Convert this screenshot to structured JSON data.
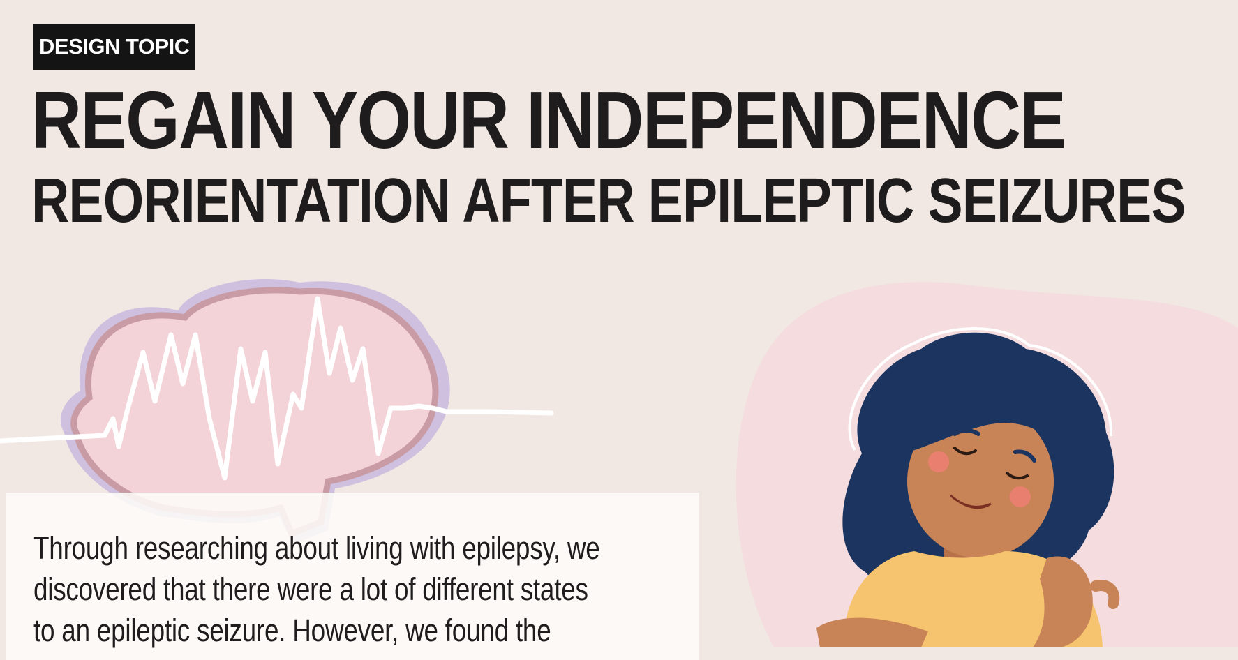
{
  "header": {
    "tag": "DESIGN TOPIC",
    "title": "REGAIN YOUR INDEPENDENCE",
    "subtitle": "REORIENTATION AFTER EPILEPTIC SEIZURES"
  },
  "intro": {
    "lines": [
      "Through researching about living with epilepsy, we",
      "discovered that there were a lot of different states",
      "to an epileptic seizure. However, we found the"
    ]
  },
  "illustrations": {
    "left": "brain-with-eeg-wave-icon",
    "right": "woman-hugging-herself-illustration"
  },
  "colors": {
    "background": "#f1e8e3",
    "text": "#1e1c1c",
    "tag_background": "#141414",
    "brain_fill": "#f3d3d8",
    "brain_outline": "#c99ba4",
    "brain_shadow": "#c5b5dc",
    "hair": "#1b3560",
    "skin": "#c88357",
    "shirt": "#f6c36e",
    "blob": "#f4dcdf"
  }
}
